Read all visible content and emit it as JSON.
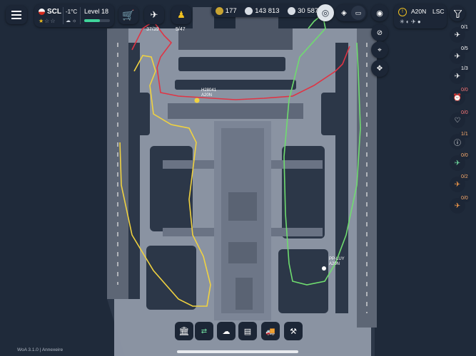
{
  "colors": {
    "background": "#1f2a3a",
    "airport": "#9aa3b2",
    "panel": "#1c2636",
    "accent_green": "#3fd49a",
    "warning": "#f0c020",
    "path_red": "#e03444",
    "path_yellow": "#f0d240",
    "path_green": "#6fdc6f",
    "aircraft_orange": "#f59a4a"
  },
  "header": {
    "menu_icon": "menu-icon",
    "airport_code": "SCL",
    "temperature": "-1°C",
    "level": "Level 18",
    "level_progress": 0.6,
    "stars_filled": 1,
    "stars_total": 3,
    "gates_count": "37/39",
    "staff_count": "5/47",
    "coins": "177",
    "money": "143 813",
    "xp": "30 587"
  },
  "weather": {
    "runway_code": "A20N",
    "airport_code": "LSC"
  },
  "aircraft": [
    {
      "callsign": "H28041",
      "type": "A20N"
    },
    {
      "callsign": "PP-LUY",
      "type": "A20N"
    }
  ],
  "sidebar": {
    "items": [
      {
        "icon": "arrivals-icon",
        "count": "0/1"
      },
      {
        "icon": "departures-icon",
        "count": "0/5"
      },
      {
        "icon": "landing-icon",
        "count": "1/3"
      },
      {
        "icon": "alarm-icon",
        "count": "0/0"
      },
      {
        "icon": "heart-icon",
        "count": "0/0"
      },
      {
        "icon": "info-icon",
        "count": "1/1"
      },
      {
        "icon": "plane-green-icon",
        "count": "0/0"
      },
      {
        "icon": "plane-orange-icon",
        "count": "0/2"
      },
      {
        "icon": "plane-orange-icon-2",
        "count": "0/0"
      }
    ]
  },
  "footer": {
    "version": "WoA 3.1.0 | Annexeire"
  }
}
